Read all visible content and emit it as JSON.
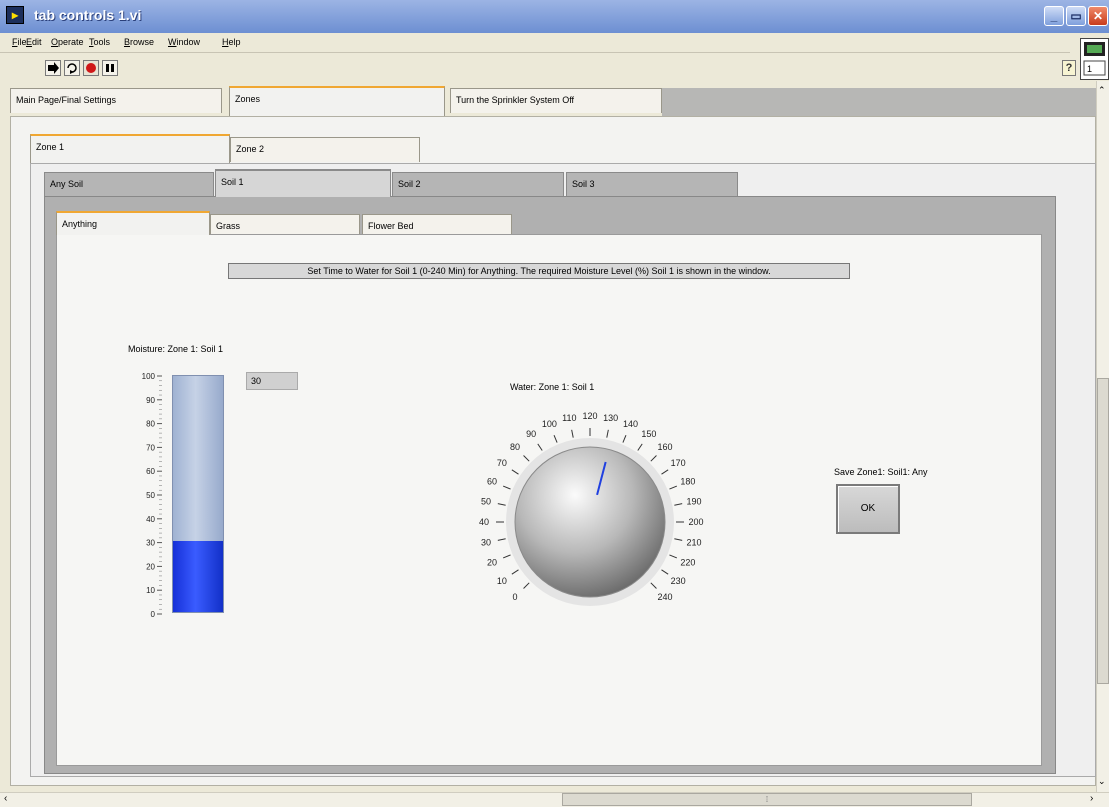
{
  "window": {
    "title": "tab controls 1.vi",
    "app_icon": "labview-icon"
  },
  "menu": {
    "items": [
      "File",
      "Edit",
      "Operate",
      "Tools",
      "Browse",
      "Window",
      "Help"
    ]
  },
  "toolbar": {
    "buttons": [
      "run-arrow-icon",
      "run-continuously-icon",
      "abort-stop-icon",
      "pause-icon"
    ],
    "help_icon": "?"
  },
  "main_tabs": {
    "items": [
      "Main Page/Final Settings",
      "Zones",
      "Turn the Sprinkler System Off"
    ],
    "active_index": 1
  },
  "zone_tabs": {
    "items": [
      "Zone 1",
      "Zone 2"
    ],
    "active_index": 0
  },
  "soil_tabs": {
    "items": [
      "Any Soil",
      "Soil 1",
      "Soil 2",
      "Soil 3"
    ],
    "active_index": 1
  },
  "plant_tabs": {
    "items": [
      "Anything",
      "Grass",
      "Flower Bed"
    ],
    "active_index": 0
  },
  "instructions": "Set Time to Water for Soil 1 (0-240 Min) for Anything. The required Moisture Level (%) Soil 1 is shown in the window.",
  "moisture": {
    "label": "Moisture: Zone 1: Soil 1",
    "value": "30",
    "level_percent": 30,
    "scale": [
      "100",
      "90",
      "80",
      "70",
      "60",
      "50",
      "40",
      "30",
      "20",
      "10",
      "0"
    ]
  },
  "water_knob": {
    "label": "Water: Zone 1: Soil 1",
    "min": 0,
    "max": 240,
    "value": 133,
    "ticks": [
      "0",
      "10",
      "20",
      "30",
      "40",
      "50",
      "60",
      "70",
      "80",
      "90",
      "100",
      "110",
      "120",
      "130",
      "140",
      "150",
      "160",
      "170",
      "180",
      "190",
      "200",
      "210",
      "220",
      "230",
      "240"
    ]
  },
  "save": {
    "label": "Save Zone1: Soil1: Any",
    "button": "OK"
  },
  "colors": {
    "tab_highlight": "#f0a732",
    "tank_fill": "#2040f0",
    "needle": "#2040e0"
  }
}
